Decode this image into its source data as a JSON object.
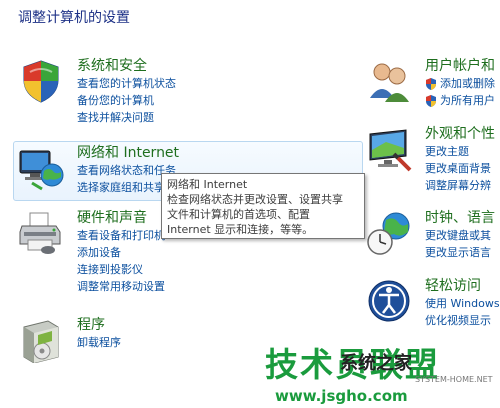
{
  "page_title": "调整计算机的设置",
  "left_categories": [
    {
      "title": "系统和安全",
      "icon": "security-shield-icon",
      "links": [
        "查看您的计算机状态",
        "备份您的计算机",
        "查找并解决问题"
      ]
    },
    {
      "title": "网络和 Internet",
      "icon": "network-globe-icon",
      "links": [
        "查看网络状态和任务",
        "选择家庭组和共享选项"
      ]
    },
    {
      "title": "硬件和声音",
      "icon": "printer-icon",
      "links": [
        "查看设备和打印机",
        "添加设备",
        "连接到投影仪",
        "调整常用移动设置"
      ]
    },
    {
      "title": "程序",
      "icon": "programs-box-icon",
      "links": [
        "卸载程序"
      ]
    }
  ],
  "right_categories": [
    {
      "title": "用户帐户和",
      "icon": "user-accounts-icon",
      "links": [
        "添加或删除",
        "为所有用户"
      ]
    },
    {
      "title": "外观和个性",
      "icon": "appearance-monitor-icon",
      "links": [
        "更改主题",
        "更改桌面背景",
        "调整屏幕分辨"
      ]
    },
    {
      "title": "时钟、语言",
      "icon": "clock-globe-icon",
      "links": [
        "更改键盘或其",
        "更改显示语言"
      ]
    },
    {
      "title": "轻松访问",
      "icon": "ease-of-access-icon",
      "links": [
        "使用 Windows",
        "优化视频显示"
      ]
    }
  ],
  "tooltip": {
    "title": "网络和 Internet",
    "lines": [
      "检查网络状态并更改设置、设置共享",
      "文件和计算机的首选项、配置",
      "Internet 显示和连接，等等。"
    ]
  },
  "watermark": {
    "main": "技术员联盟",
    "sub": "系统之家",
    "url": "www.jsgho.com",
    "small": "SYSTEM-HOME.NET"
  },
  "colors": {
    "title": "#1e3287",
    "category": "#1e6e1e",
    "link": "#0b4f9e",
    "watermark": "#1a9b3d"
  }
}
